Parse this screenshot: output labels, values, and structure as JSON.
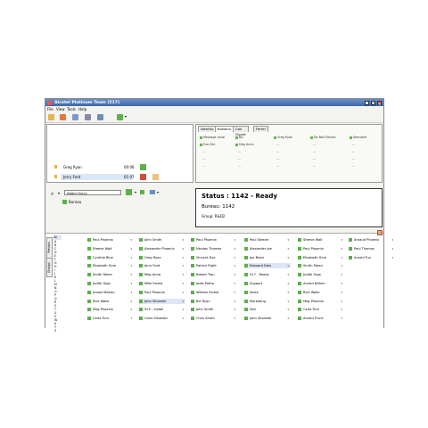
{
  "window": {
    "title": "Alcatel Platinum Team (517)"
  },
  "menu": [
    "File",
    "View",
    "Tools",
    "Help"
  ],
  "calls": [
    {
      "name": "Greg Ryan",
      "time": "00:06"
    },
    {
      "name": "Jerry Ford",
      "time": "01:07"
    }
  ],
  "tabs": [
    "Identity",
    "Buttons",
    "Call Guard",
    "Fertel"
  ],
  "fkeys": [
    [
      "Message vocal",
      "Bis",
      "Greg Ryan",
      "Do Not Disturb",
      "Standard"
    ],
    [
      "Eva Zen",
      "Meg Anna",
      "...",
      "...",
      "..."
    ],
    [
      "...",
      "...",
      "...",
      "...",
      "..."
    ],
    [
      "...",
      "...",
      "...",
      "...",
      "..."
    ],
    [
      "...",
      "...",
      "...",
      "...",
      "..."
    ]
  ],
  "dial": {
    "value": "Adam Hurry",
    "group_label": "Bureau"
  },
  "status": {
    "title": "Status : 1142 - Ready",
    "desk": "Bureau: 1142",
    "group": "Group: R&D2"
  },
  "directory": {
    "all_label": "All",
    "letters": [
      "A",
      "B",
      "C",
      "D",
      "E",
      "F",
      "G",
      "H",
      "I",
      "J",
      "K",
      "L",
      "M",
      "N",
      "O",
      "P",
      "Q",
      "R",
      "S",
      "T",
      "U",
      "V",
      "W",
      "X",
      "Y",
      "Z"
    ],
    "vtabs": [
      "Persons",
      "Groups"
    ],
    "columns": [
      [
        "Paul Phoenix",
        "Steeve Walt",
        "Cynthia Blue",
        "Elisabeth Gine",
        "Smith Taken",
        "Judith Giga",
        "Arnold Nithen",
        "Rick Wallo",
        "Meg Phoenix",
        "Carla Turn"
      ],
      [
        "John Smith",
        "Alexander Phoenix",
        "Greg Ryan",
        "Jerry Ford",
        "Meg Anna",
        "Mike Forest",
        "Paul Phoenix",
        "John Silvester",
        "525 - Install",
        "Carla Silvester"
      ],
      [
        "Paul Phoenix",
        "Nicolas Thomas",
        "Vincent Doc",
        "Patrick Right",
        "Robert Tron",
        "Jodie Paltro",
        "William Forest",
        "Bill Ryan",
        "John Smith",
        "Chris Smith"
      ],
      [
        "Paul Steeve",
        "Alexander Joe",
        "Joe Black",
        "Edouard Ewis",
        "517 - Ready",
        "Support",
        "Sales",
        "Marketing",
        "Dev",
        "John Silvester"
      ],
      [
        "Steeve Walt",
        "Paul Phoenix",
        "Elisabeth Gine",
        "Smith Taken",
        "Judith Giga",
        "Arnold Nithen",
        "Rick Wallo",
        "Meg Phoenix",
        "Carla Turn",
        "Arnold Trunk"
      ],
      [
        "Arnaud Phoenix",
        "Paul Thomas",
        "Arnold Tux"
      ]
    ]
  },
  "colors": {
    "title_bar": "#3f67a8",
    "ready_green": "#5db04a",
    "hangup_red": "#d84a3a"
  }
}
